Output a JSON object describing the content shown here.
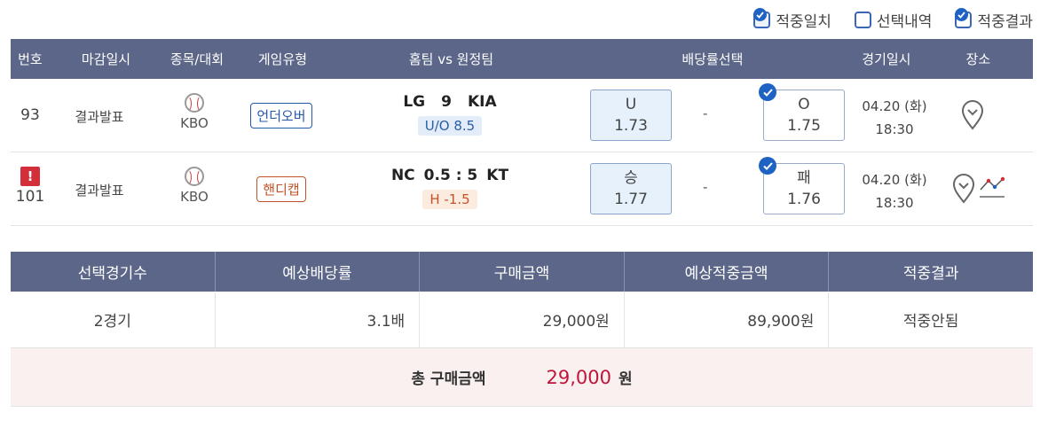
{
  "legend": [
    {
      "label": "적중일치",
      "checked": true
    },
    {
      "label": "선택내역",
      "checked": false
    },
    {
      "label": "적중결과",
      "checked": true
    }
  ],
  "table_headers": [
    "번호",
    "마감일시",
    "종목/대회",
    "게임유형",
    "홈팀 vs 원정팀",
    "배당률선택",
    "경기일시",
    "장소"
  ],
  "rows": [
    {
      "no": "93",
      "close": "결과발표",
      "league": "KBO",
      "game_type": "언더오버",
      "home": "LG",
      "score": "9",
      "away": "KIA",
      "sub": "U/O 8.5",
      "opt1_label": "U",
      "opt1_odds": "1.73",
      "mid": "-",
      "opt2_label": "O",
      "opt2_odds": "1.75",
      "date": "04.20 (화)",
      "time": "18:30",
      "alert": false
    },
    {
      "no": "101",
      "close": "결과발표",
      "league": "KBO",
      "game_type": "핸디캡",
      "home": "NC",
      "score": "0.5 : 5",
      "away": "KT",
      "sub": "H -1.5",
      "opt1_label": "승",
      "opt1_odds": "1.77",
      "mid": "-",
      "opt2_label": "패",
      "opt2_odds": "1.76",
      "date": "04.20 (화)",
      "time": "18:30",
      "alert": true,
      "alert_symbol": "!"
    }
  ],
  "summary": {
    "headers": [
      "선택경기수",
      "예상배당률",
      "구매금액",
      "예상적중금액",
      "적중결과"
    ],
    "values": [
      "2경기",
      "3.1배",
      "29,000원",
      "89,900원",
      "적중안됨"
    ]
  },
  "total": {
    "label": "총 구매금액",
    "amount": "29,000",
    "unit": "원"
  },
  "colors": {
    "header_bg": "#5b6688",
    "accent_blue": "#1e63c4",
    "total_red": "#c0153a",
    "total_bg": "#fbf0f0"
  }
}
